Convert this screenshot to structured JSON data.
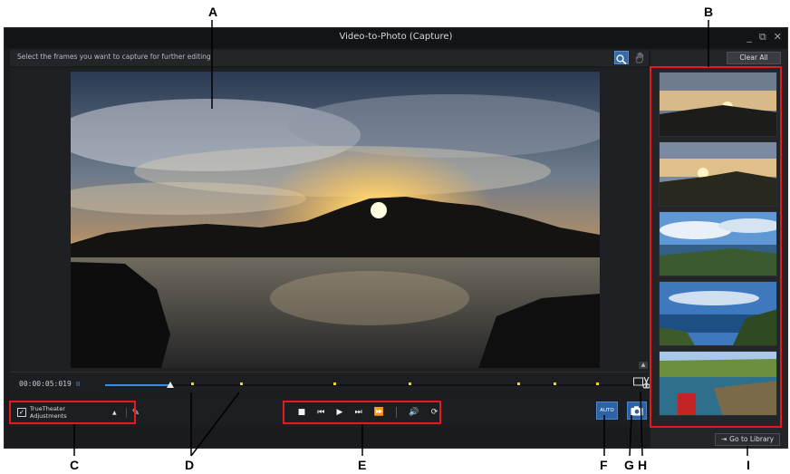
{
  "window": {
    "title": "Video-to-Photo (Capture)",
    "minimize_glyph": "_",
    "restore_glyph": "⧉",
    "close_glyph": "✕"
  },
  "toolbar": {
    "instruction": "Select the frames you want to capture for further editing.",
    "zoom_icon": "magnifier-icon",
    "hand_icon": "hand-icon"
  },
  "timeline": {
    "timecode": "00:00:05:019",
    "pause_glyph": "II",
    "progress": 0.12
  },
  "controls": {
    "trutheater_label": "TrueTheater Adjustments",
    "trutheater_checked": true,
    "auto_label": "AUTO"
  },
  "sidebar": {
    "clear_all": "Clear All",
    "go_to_library": "Go to Library"
  },
  "callouts": {
    "A": "A",
    "B": "B",
    "C": "C",
    "D": "D",
    "E": "E",
    "F": "F",
    "G": "G",
    "H": "H",
    "I": "I"
  },
  "colors": {
    "accent": "#2b63a6",
    "highlight_box": "#e31b1b",
    "marker": "#ffd400"
  }
}
